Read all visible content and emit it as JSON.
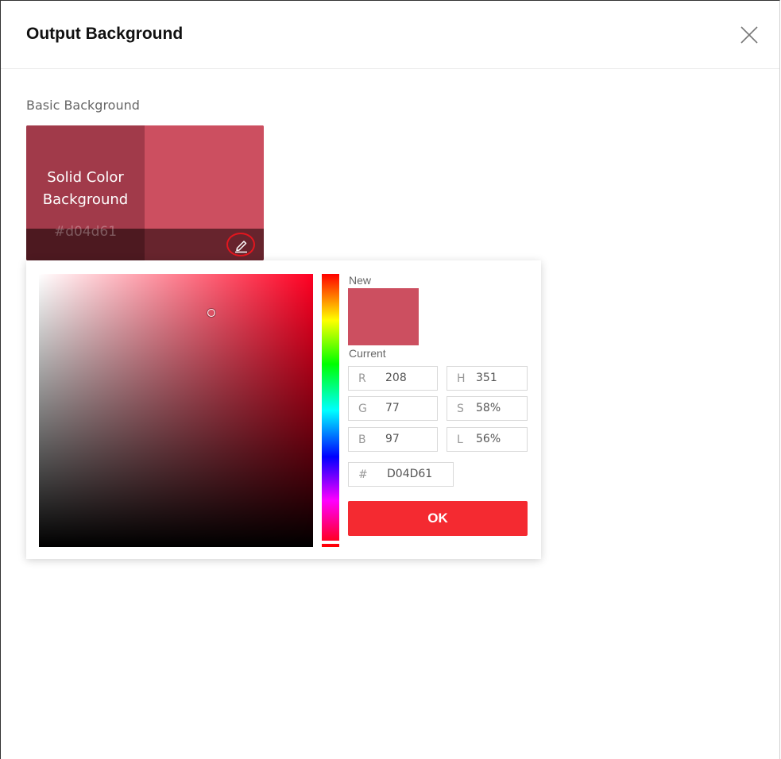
{
  "dialog": {
    "title": "Output Background"
  },
  "section": {
    "label": "Basic Background"
  },
  "tile": {
    "name": "Solid Color Background",
    "hex": "#d04d61",
    "color": "#cc4f60"
  },
  "picker": {
    "new_label": "New",
    "current_label": "Current",
    "rgb": {
      "r_key": "R",
      "r": "208",
      "g_key": "G",
      "g": "77",
      "b_key": "B",
      "b": "97"
    },
    "hsl": {
      "h_key": "H",
      "h": "351",
      "s_key": "S",
      "s": "58%",
      "l_key": "L",
      "l": "56%"
    },
    "hex_key": "#",
    "hex": "D04D61",
    "ok_label": "OK",
    "accent_color": "#f42a31"
  },
  "icons": {
    "close": "close-icon",
    "edit": "pencil-icon"
  }
}
